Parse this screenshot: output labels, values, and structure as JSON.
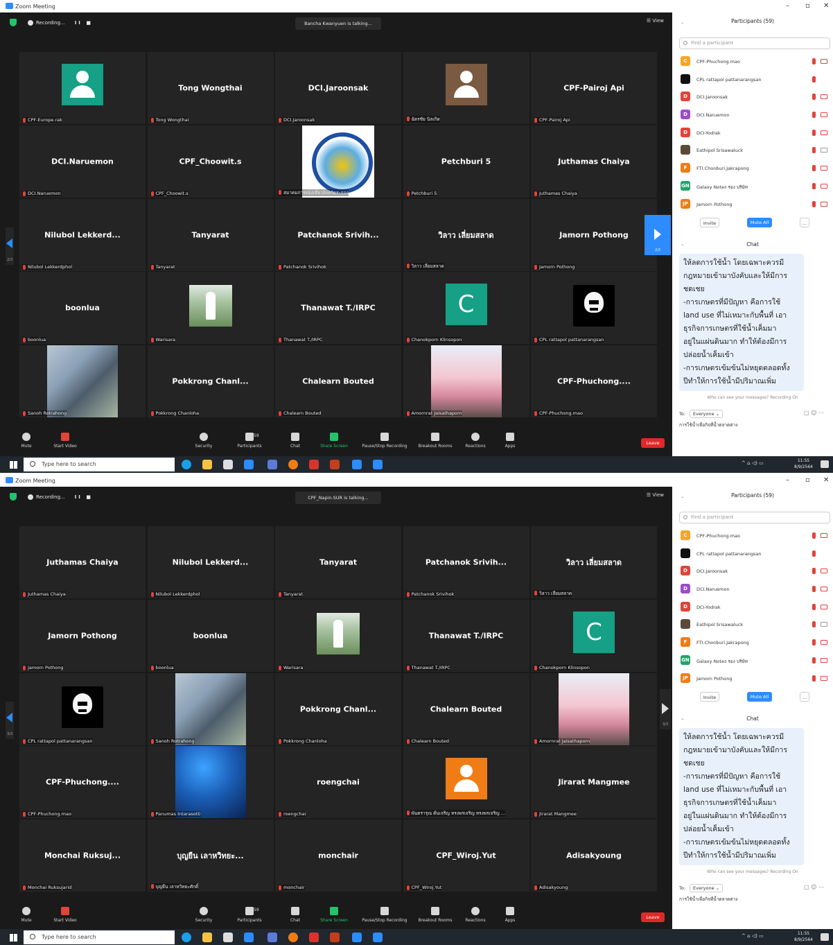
{
  "screens": [
    {
      "title": "Zoom Meeting",
      "recording_label": "Recording...",
      "recording_controls": "II ■",
      "talking": "Bancha Kwanyuen is talking...",
      "view_label": "View",
      "nav_left_page": "2/3",
      "nav_right_page": "2/3",
      "tiles": [
        {
          "big": "",
          "label": "CPF-Europe.rak",
          "visual": "avatar-green"
        },
        {
          "big": "Tong Wongthai",
          "label": "Tong Wongthai",
          "visual": "none"
        },
        {
          "big": "DCI.Jaroonsak",
          "label": "DCI.Jaroonsak",
          "visual": "none"
        },
        {
          "big": "",
          "label": "ฉัตรชัย นิลเกิด",
          "visual": "avatar-brown"
        },
        {
          "big": "CPF-Pairoj Api",
          "label": "CPF-Pairoj Api",
          "visual": "none"
        },
        {
          "big": "DCI.Naruemon",
          "label": "DCI.Naruemon",
          "visual": "none"
        },
        {
          "big": "CPF_Choowit.s",
          "label": "CPF_Choowit.s",
          "visual": "none"
        },
        {
          "big": "",
          "label": "สมาคมการท่องเที่ยวจังหวัดระยอง",
          "visual": "logo"
        },
        {
          "big": "Petchburi 5",
          "label": "Petchburi 5",
          "visual": "none"
        },
        {
          "big": "Juthamas Chaiya",
          "label": "Juthamas Chaiya",
          "visual": "none"
        },
        {
          "big": "Nilubol Lekkerd...",
          "label": "Nilubol Lekkerdphol",
          "visual": "none"
        },
        {
          "big": "Tanyarat",
          "label": "Tanyarat",
          "visual": "none"
        },
        {
          "big": "Patchanok Srivih...",
          "label": "Patchanok Srivihok",
          "visual": "none"
        },
        {
          "big": "วิลาว เลี่ยมสลาด",
          "label": "วิลาว เลี่ยมสลาด",
          "visual": "none"
        },
        {
          "big": "Jamorn Pothong",
          "label": "Jamorn Pothong",
          "visual": "none"
        },
        {
          "big": "boonlua",
          "label": "boonlua",
          "visual": "none"
        },
        {
          "big": "",
          "label": "Warisara",
          "visual": "photo-man"
        },
        {
          "big": "Thanawat T./IRPC",
          "label": "Thanawat T./IRPC",
          "visual": "none"
        },
        {
          "big": "",
          "label": "Chanokporn Klinsopon",
          "visual": "avatar-c"
        },
        {
          "big": "",
          "label": "CPL rattapol pattanarangsan",
          "visual": "skull"
        },
        {
          "big": "",
          "label": "Sanoh Rotrahong",
          "visual": "photo-office"
        },
        {
          "big": "Pokkrong  Chanl...",
          "label": "Pokkrong Chanloha",
          "visual": "none"
        },
        {
          "big": "Chalearn Bouted",
          "label": "Chalearn Bouted",
          "visual": "none"
        },
        {
          "big": "",
          "label": "Amornrat Jaisathaporn",
          "visual": "photo-pink"
        },
        {
          "big": "CPF-Phuchong....",
          "label": "CPF-Phuchong.mao",
          "visual": "none"
        }
      ]
    },
    {
      "title": "Zoom Meeting",
      "recording_label": "Recording...",
      "recording_controls": "II ■",
      "talking": "CPF_Napin.SUR is talking...",
      "view_label": "View",
      "nav_left_page": "3/3",
      "nav_right_page": "3/3",
      "tiles": [
        {
          "big": "Juthamas Chaiya",
          "label": "Juthamas Chaiya",
          "visual": "none"
        },
        {
          "big": "Nilubol  Lekkerd...",
          "label": "Nilubol Lekkerdphol",
          "visual": "none"
        },
        {
          "big": "Tanyarat",
          "label": "Tanyarat",
          "visual": "none"
        },
        {
          "big": "Patchanok  Srivih...",
          "label": "Patchanok Srivihok",
          "visual": "none"
        },
        {
          "big": "วิลาว เลี่ยมสลาด",
          "label": "วิลาว เลี่ยมสลาด",
          "visual": "none"
        },
        {
          "big": "Jamorn Pothong",
          "label": "Jamorn Pothong",
          "visual": "none"
        },
        {
          "big": "boonlua",
          "label": "boonlua",
          "visual": "none"
        },
        {
          "big": "",
          "label": "Warisara",
          "visual": "photo-man"
        },
        {
          "big": "Thanawat T./IRPC",
          "label": "Thanawat T./IRPC",
          "visual": "none"
        },
        {
          "big": "",
          "label": "Chanokporn Klinsopon",
          "visual": "avatar-c"
        },
        {
          "big": "",
          "label": "CPL rattapol pattanarangsan",
          "visual": "skull"
        },
        {
          "big": "",
          "label": "Sanoh Rotrahong",
          "visual": "photo-office"
        },
        {
          "big": "Pokkrong  Chanl...",
          "label": "Pokkrong Chanloha",
          "visual": "none"
        },
        {
          "big": "Chalearn Bouted",
          "label": "Chalearn Bouted",
          "visual": "none"
        },
        {
          "big": "",
          "label": "Amornrat Jaisathaporn",
          "visual": "photo-pink"
        },
        {
          "big": "CPF-Phuchong....",
          "label": "CPF-Phuchong.mao",
          "visual": "none"
        },
        {
          "big": "",
          "label": "Panumas Intarasotti",
          "visual": "photo-blue"
        },
        {
          "big": "roengchai",
          "label": "roengchai",
          "visual": "none"
        },
        {
          "big": "",
          "label": "พันตรารุณ ดั่นเจริญ ทรงพรเจริญ ทรงพรเจริญ ...",
          "visual": "avatar-orange"
        },
        {
          "big": "Jirarat Mangmee",
          "label": "Jirarat Mangmee",
          "visual": "none"
        },
        {
          "big": "Monchai  Ruksuj...",
          "label": "Monchai Ruksujarid",
          "visual": "none"
        },
        {
          "big": "บุญยืน เลาหวิทยะ...",
          "label": "บุญยืน เลาหวิทยะศักดิ์",
          "visual": "none"
        },
        {
          "big": "monchair",
          "label": "monchair",
          "visual": "none"
        },
        {
          "big": "CPF_Wiroj.Yut",
          "label": "CPF_Wiroj.Yut",
          "visual": "none"
        },
        {
          "big": "Adisakyoung",
          "label": "Adisakyoung",
          "visual": "none"
        }
      ]
    }
  ],
  "toolbar": {
    "mute": "Mute",
    "start_video": "Start Video",
    "security": "Security",
    "participants": "Participants",
    "participants_count": "59",
    "chat": "Chat",
    "share_screen": "Share Screen",
    "pause_recording": "Pause/Stop Recording",
    "breakout": "Breakout Rooms",
    "reactions": "Reactions",
    "apps": "Apps",
    "leave": "Leave"
  },
  "panel": {
    "participants_title": "Participants (59)",
    "search_placeholder": "Find a participant",
    "participants": [
      {
        "initial": "C",
        "color": "#f5a623",
        "name": "CPF-Phuchong.mao"
      },
      {
        "initial": "",
        "color": "#111111",
        "name": "CPL rattapol pattanarangsan"
      },
      {
        "initial": "D",
        "color": "#e0443a",
        "name": "DCI.Jaroonsak"
      },
      {
        "initial": "D",
        "color": "#9b4dca",
        "name": "DCI.Naruemon"
      },
      {
        "initial": "D",
        "color": "#e0443a",
        "name": "DCI-Yodrak"
      },
      {
        "initial": "",
        "color": "#5a4a3a",
        "name": "Eathipol Srisawaluck"
      },
      {
        "initial": "F",
        "color": "#f07c16",
        "name": "FTI.Chonburi.Jakrapong"
      },
      {
        "initial": "GN",
        "color": "#23a36b",
        "name": "Galaxy Noteง รอง บริษัท"
      },
      {
        "initial": "JP",
        "color": "#f07c16",
        "name": "Jamorn Pothong"
      }
    ],
    "invite": "Invite",
    "mute_all": "Mute All",
    "more": "...",
    "chat_title": "Chat",
    "chat_message": "ให้ลดการใช้น้ำ โดยเฉพาะควรมี\nกฎหมายเข้ามาบังคับและให้มีการ\nชดเชย\n-การเกษตรที่มีปัญหา คือการใช้\nland use ที่ไม่เหมาะกับพื้นที่ เอา\nธุรกิจการเกษตรที่ใช้น้ำเค็มมา\nอยู่ในแผ่นดินมาก ทำให้ต้องมีการ\nปล่อยน้ำเค็มเข้า\n-การเกษตรเข้มข้นไม่หยุดตลอดทั้ง\nปีทำให้การใช้น้ำมีปริมาณเพิ่ม",
    "who_can_see": "Who can see your messages? Recording On",
    "to_label": "To:",
    "to_value": "Everyone",
    "chat_input": "การใช้น้ำเพื่อกิจที่น้ำตลาดต่าง"
  },
  "taskbar": {
    "search_placeholder": "Type here to search",
    "time": "11:55",
    "date": "8/9/2564"
  }
}
